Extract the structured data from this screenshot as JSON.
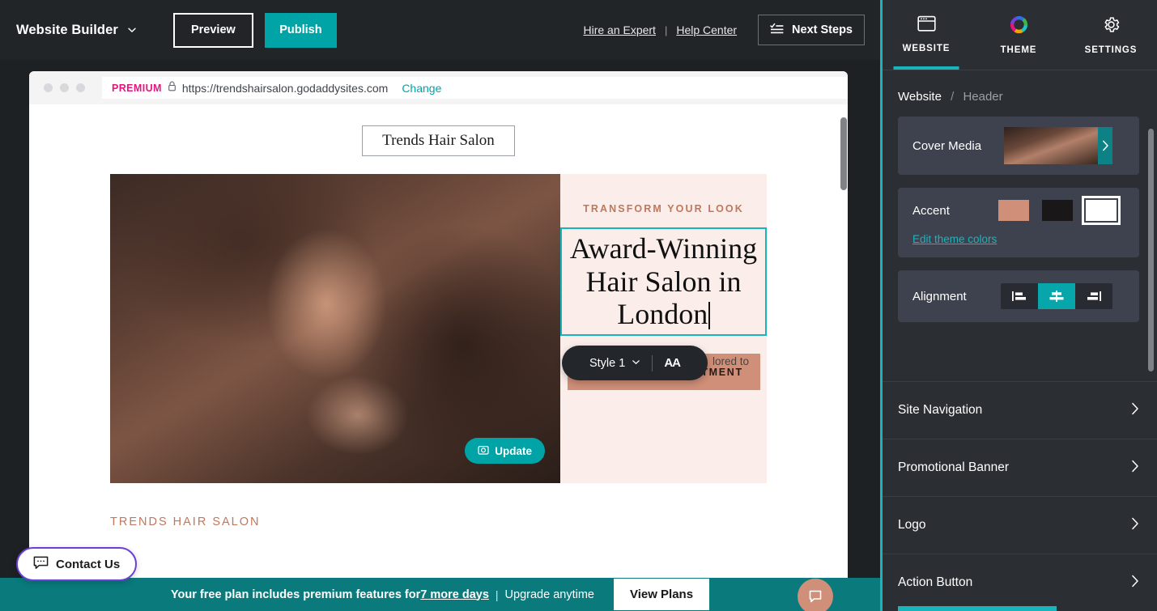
{
  "topbar": {
    "brand": "Website Builder",
    "preview_label": "Preview",
    "publish_label": "Publish",
    "hire_expert": "Hire an Expert",
    "separator": "|",
    "help_center": "Help Center",
    "next_steps": "Next Steps"
  },
  "browser": {
    "badge": "PREMIUM",
    "url": "https://trendshairsalon.godaddysites.com",
    "change_label": "Change"
  },
  "site": {
    "title": "Trends Hair Salon",
    "eyebrow": "TRANSFORM YOUR LOOK",
    "headline": "Award-Winning Hair Salon in London",
    "subtext_fragment": "lored to",
    "cta_label": "SCHEDULE APPOINTMENT",
    "update_label": "Update",
    "footer_brand": "TRENDS HAIR SALON"
  },
  "text_toolbar": {
    "style_label": "Style 1",
    "font_size_label": "AA"
  },
  "widgets": {
    "contact_us": "Contact Us"
  },
  "bottom_banner": {
    "text_before": "Your free plan includes premium features for ",
    "days_link": "7 more days",
    "pipe": "|",
    "text_after": "Upgrade anytime",
    "button_label": "View Plans"
  },
  "panel": {
    "tabs": [
      {
        "label": "WEBSITE",
        "icon": "browser-window-icon",
        "active": true
      },
      {
        "label": "THEME",
        "icon": "color-wheel-icon",
        "active": false
      },
      {
        "label": "SETTINGS",
        "icon": "gear-icon",
        "active": false
      }
    ],
    "breadcrumb": {
      "root": "Website",
      "separator": "/",
      "current": "Header"
    },
    "cover_media": {
      "label": "Cover Media"
    },
    "accent": {
      "label": "Accent",
      "swatches": [
        {
          "name": "salmon",
          "color": "#d08f78",
          "selected": false
        },
        {
          "name": "dark",
          "color": "#1a1718",
          "selected": false
        },
        {
          "name": "white",
          "color": "#ffffff",
          "selected": true
        }
      ],
      "edit_link": "Edit theme colors"
    },
    "alignment": {
      "label": "Alignment",
      "options": [
        {
          "name": "align-left",
          "active": false
        },
        {
          "name": "align-center",
          "active": true
        },
        {
          "name": "align-right",
          "active": false
        }
      ]
    },
    "sections": [
      {
        "label": "Site Navigation"
      },
      {
        "label": "Promotional Banner"
      },
      {
        "label": "Logo"
      },
      {
        "label": "Action Button"
      }
    ]
  },
  "colors": {
    "teal": "#19b5bd",
    "publish_teal": "#00a4a6",
    "banner_teal": "#0a7a7c",
    "premium_pink": "#e5157f",
    "accent_salmon": "#d08f78",
    "panel_bg": "#2b2e32",
    "card_bg": "#3e424e",
    "topbar_bg": "#222528"
  }
}
